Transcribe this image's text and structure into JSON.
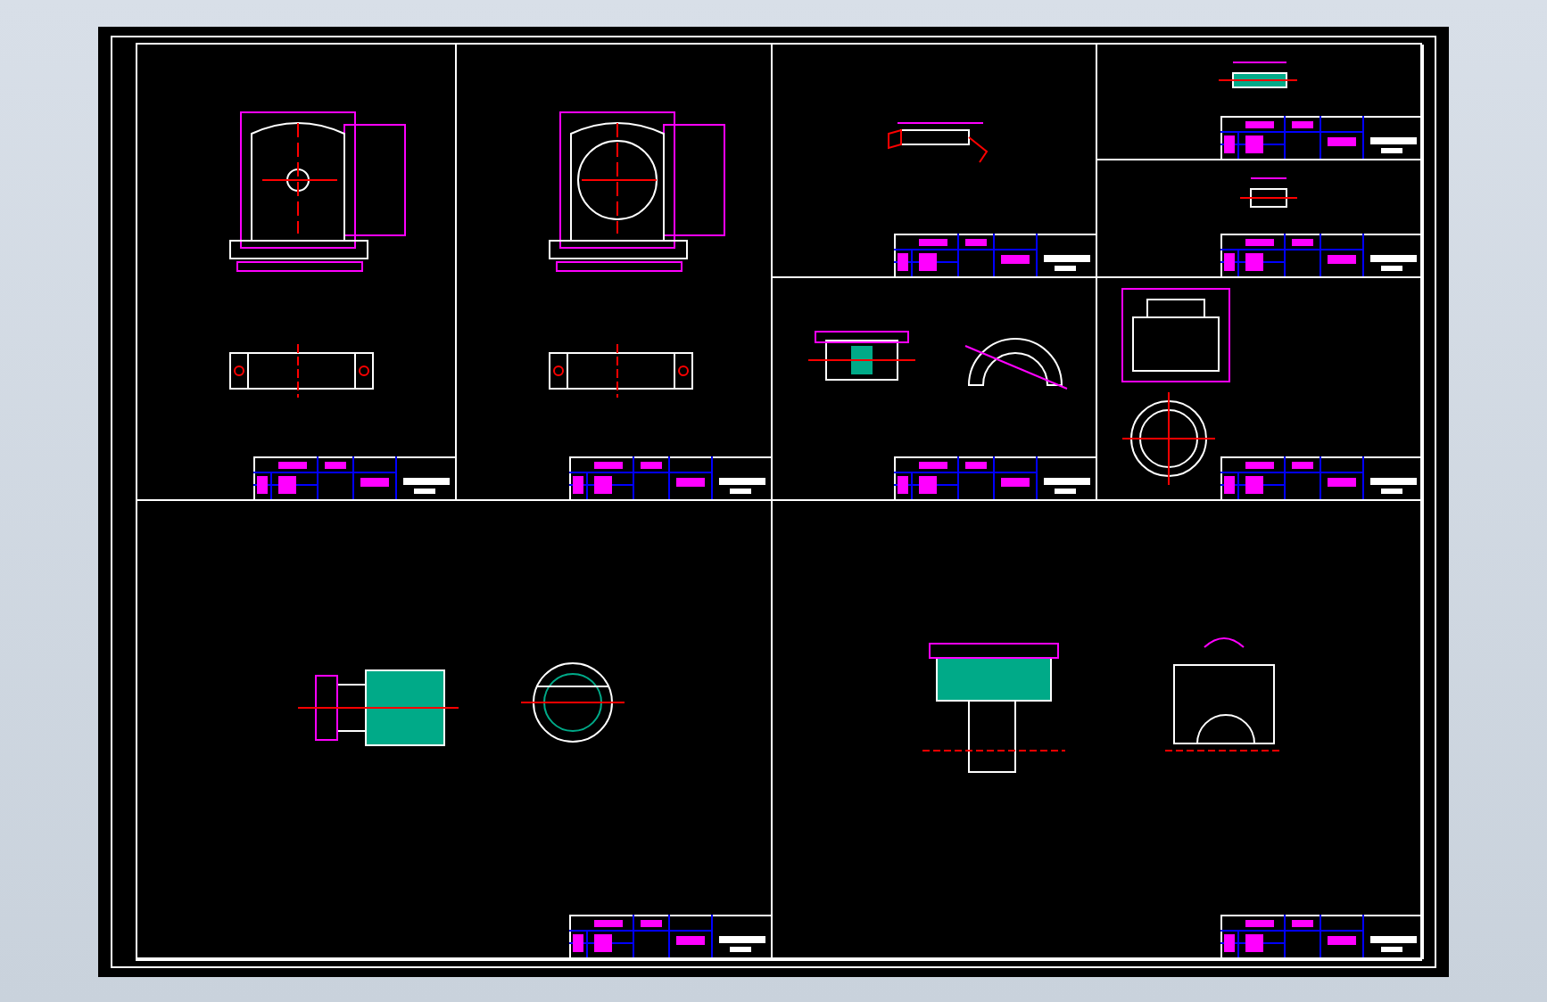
{
  "sheet": {
    "panels": [
      {
        "kind": "bracket",
        "title_block": true
      },
      {
        "kind": "bored-bracket",
        "title_block": true
      },
      {
        "kind": "pin",
        "title_block": true
      },
      {
        "kind": "key",
        "title_block": true
      },
      {
        "kind": "small-part",
        "title_block": true
      },
      {
        "kind": "section-arc",
        "title_block": true
      },
      {
        "kind": "cap-ring",
        "title_block": true
      },
      {
        "kind": "hatched-ring",
        "title_block": true
      },
      {
        "kind": "fixture",
        "title_block": true
      }
    ]
  }
}
